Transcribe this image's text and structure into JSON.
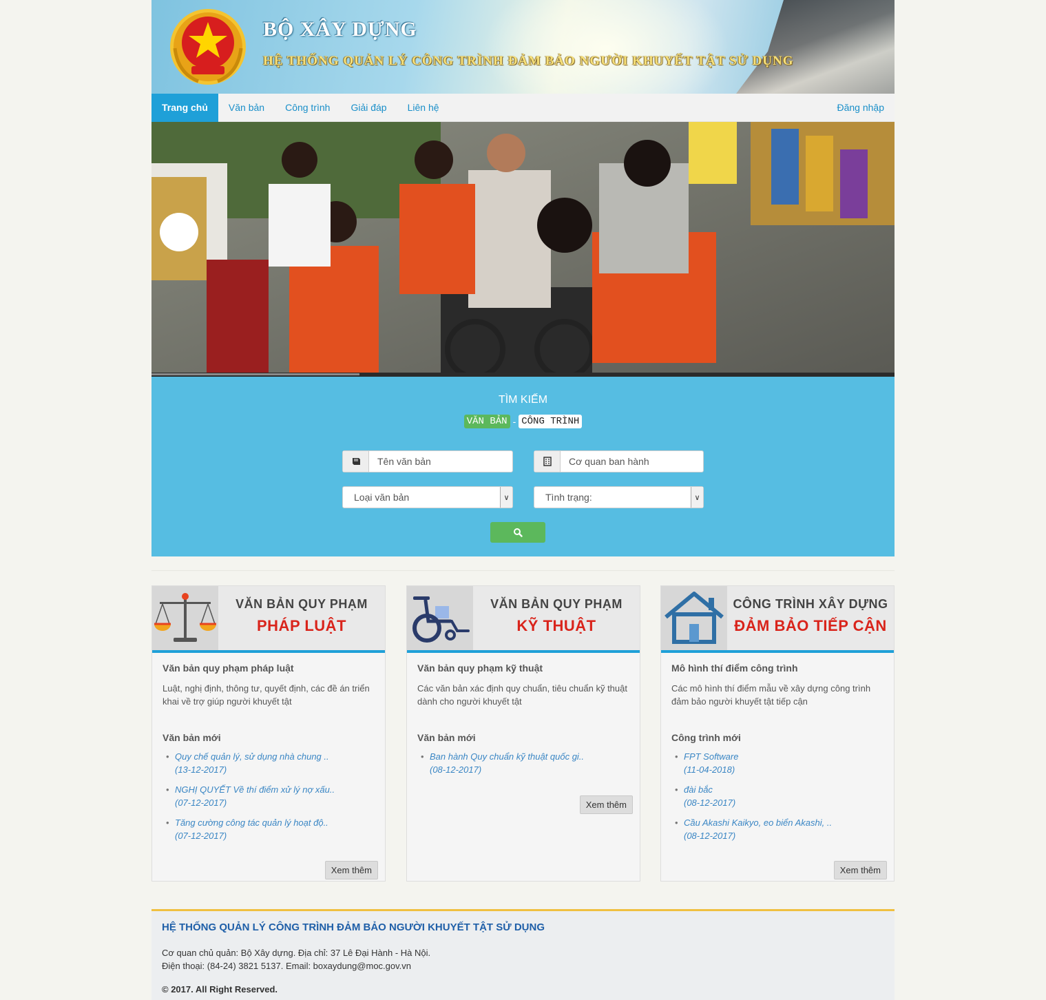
{
  "header": {
    "title": "BỘ XÂY DỰNG",
    "subtitle": "HỆ THỐNG QUẢN LÝ CÔNG TRÌNH ĐẢM BẢO NGƯỜI KHUYẾT TẬT SỬ DỤNG",
    "emblem_icon": "national-emblem-icon"
  },
  "nav": {
    "items": [
      "Trang chủ",
      "Văn bản",
      "Công trình",
      "Giải đáp",
      "Liên hệ"
    ],
    "active_index": 0,
    "login": "Đăng nhập"
  },
  "hero": {
    "slider_progress": 0.28
  },
  "search": {
    "title": "TÌM KIẾM",
    "tab_documents": "VĂN BẢN",
    "tab_separator": "-",
    "tab_works": "CÔNG TRÌNH",
    "doc_name_placeholder": "Tên văn bản",
    "agency_placeholder": "Cơ quan ban hành",
    "doc_type_value": "Loại văn bản",
    "status_value": "Tình trạng:",
    "search_icon": "search-icon",
    "colors": {
      "panel": "#56bde2",
      "button": "#5cb85c"
    }
  },
  "cards": [
    {
      "head1": "VĂN BẢN QUY PHẠM",
      "head2": "PHÁP LUẬT",
      "icon": "scales-icon",
      "subtitle": "Văn bản quy phạm pháp luật",
      "desc": "Luật, nghị định, thông tư, quyết định, các đề án triển khai về trợ giúp người khuyết tật",
      "new_title": "Văn bản mới",
      "items": [
        {
          "title": "Quy chế quản lý, sử dụng nhà chung ..",
          "date": "(13-12-2017)"
        },
        {
          "title": "NGHỊ QUYẾT Về thí điểm xử lý nợ xấu..",
          "date": "(07-12-2017)"
        },
        {
          "title": "Tăng cường công tác quản lý hoạt độ..",
          "date": "(07-12-2017)"
        }
      ],
      "more": "Xem thêm"
    },
    {
      "head1": "VĂN BẢN QUY PHẠM",
      "head2": "KỸ THUẬT",
      "icon": "wheelchair-icon",
      "subtitle": "Văn bản quy phạm kỹ thuật",
      "desc": "Các văn bản xác định quy chuẩn, tiêu chuẩn kỹ thuật dành cho người khuyết tật",
      "new_title": "Văn bản mới",
      "items": [
        {
          "title": "Ban hành Quy chuẩn kỹ thuật quốc gi..",
          "date": "(08-12-2017)"
        }
      ],
      "more": "Xem thêm"
    },
    {
      "head1": "CÔNG TRÌNH XÂY DỰNG",
      "head2": "ĐẢM BẢO TIẾP CẬN",
      "icon": "house-icon",
      "subtitle": "Mô hình thí điểm công trình",
      "desc": "Các mô hình thí điểm mẫu về xây dựng công trình đảm bảo người khuyết tật tiếp cận",
      "new_title": "Công trình mới",
      "items": [
        {
          "title": "FPT Software",
          "date": "(11-04-2018)"
        },
        {
          "title": "đài bắc",
          "date": "(08-12-2017)"
        },
        {
          "title": "Cầu Akashi Kaikyo, eo biển Akashi, ..",
          "date": "(08-12-2017)"
        }
      ],
      "more": "Xem thêm"
    }
  ],
  "footer": {
    "title": "HỆ THỐNG QUẢN LÝ CÔNG TRÌNH ĐẢM BẢO NGƯỜI KHUYẾT TẬT SỬ DỤNG",
    "line1": "Cơ quan chủ quản: Bộ Xây dựng. Địa chỉ: 37 Lê Đại Hành - Hà Nội.",
    "line2": "Điện thoại: (84-24) 3821 5137. Email: boxaydung@moc.gov.vn",
    "copyright": "© 2017. All Right Reserved."
  }
}
